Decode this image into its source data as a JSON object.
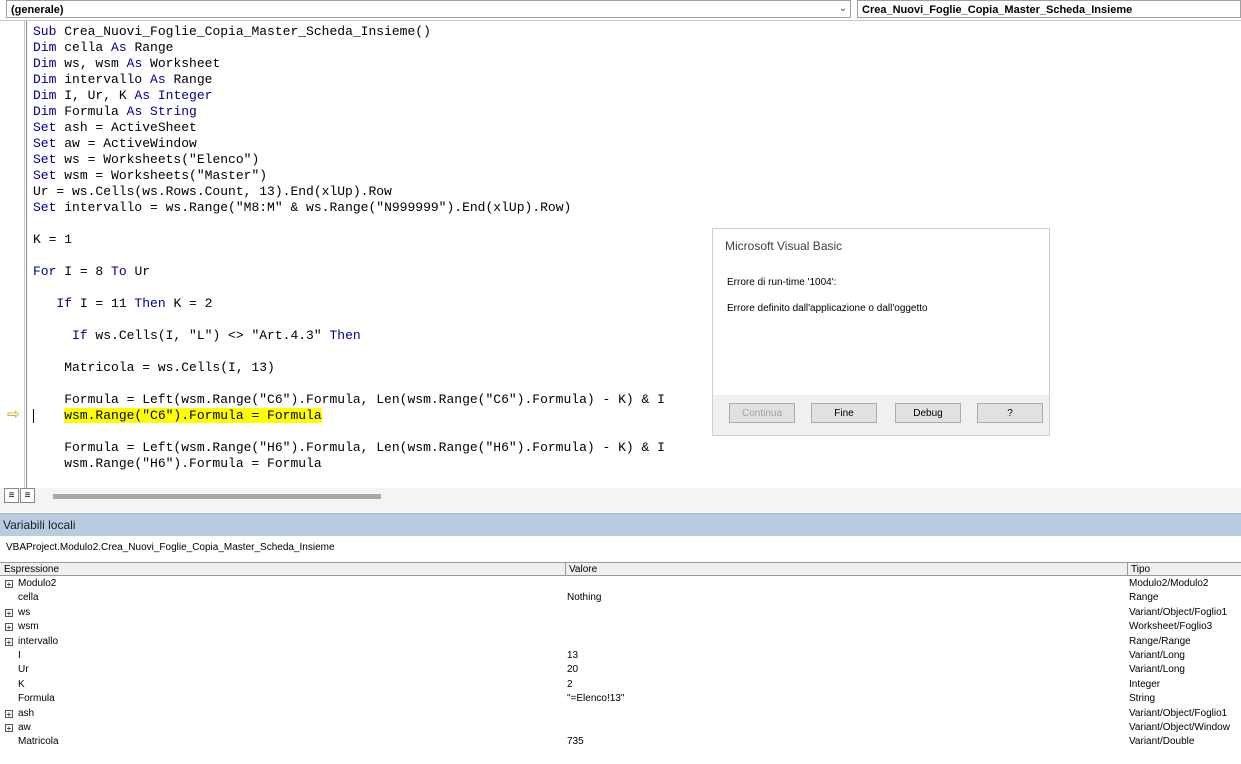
{
  "toolbar": {
    "object_combo": "(generale)",
    "procedure_combo": "Crea_Nuovi_Foglie_Copia_Master_Scheda_Insieme"
  },
  "code_lines": [
    [
      {
        "t": "Sub ",
        "k": true
      },
      {
        "t": "Crea_Nuovi_Foglie_Copia_Master_Scheda_Insieme()"
      }
    ],
    [
      {
        "t": "Dim ",
        "k": true
      },
      {
        "t": "cella "
      },
      {
        "t": "As ",
        "k": true
      },
      {
        "t": "Range"
      }
    ],
    [
      {
        "t": "Dim ",
        "k": true
      },
      {
        "t": "ws, wsm "
      },
      {
        "t": "As ",
        "k": true
      },
      {
        "t": "Worksheet"
      }
    ],
    [
      {
        "t": "Dim ",
        "k": true
      },
      {
        "t": "intervallo "
      },
      {
        "t": "As ",
        "k": true
      },
      {
        "t": "Range"
      }
    ],
    [
      {
        "t": "Dim ",
        "k": true
      },
      {
        "t": "I, Ur, K "
      },
      {
        "t": "As Integer",
        "k": true
      }
    ],
    [
      {
        "t": "Dim ",
        "k": true
      },
      {
        "t": "Formula "
      },
      {
        "t": "As String",
        "k": true
      }
    ],
    [
      {
        "t": "Set ",
        "k": true
      },
      {
        "t": "ash = ActiveSheet"
      }
    ],
    [
      {
        "t": "Set ",
        "k": true
      },
      {
        "t": "aw = ActiveWindow"
      }
    ],
    [
      {
        "t": "Set ",
        "k": true
      },
      {
        "t": "ws = Worksheets(\"Elenco\")"
      }
    ],
    [
      {
        "t": "Set ",
        "k": true
      },
      {
        "t": "wsm = Worksheets(\"Master\")"
      }
    ],
    [
      {
        "t": "Ur = ws.Cells(ws.Rows.Count, 13).End(xlUp).Row"
      }
    ],
    [
      {
        "t": "Set ",
        "k": true
      },
      {
        "t": "intervallo = ws.Range(\"M8:M\" & ws.Range(\"N999999\").End(xlUp).Row)"
      }
    ],
    [],
    [
      {
        "t": "K = 1"
      }
    ],
    [],
    [
      {
        "t": "For ",
        "k": true
      },
      {
        "t": "I = 8 "
      },
      {
        "t": "To ",
        "k": true
      },
      {
        "t": "Ur"
      }
    ],
    [],
    [
      {
        "t": "   "
      },
      {
        "t": "If ",
        "k": true
      },
      {
        "t": "I = 11 "
      },
      {
        "t": "Then ",
        "k": true
      },
      {
        "t": "K = 2"
      }
    ],
    [],
    [
      {
        "t": "     "
      },
      {
        "t": "If ",
        "k": true
      },
      {
        "t": "ws.Cells(I, \"L\") <> \"Art.4.3\" "
      },
      {
        "t": "Then",
        "k": true
      }
    ],
    [],
    [
      {
        "t": "    Matricola = ws.Cells(I, 13)"
      }
    ],
    [],
    [
      {
        "t": "    Formula = Left(wsm.Range(\"C6\").Formula, Len(wsm.Range(\"C6\").Formula) - K) & I"
      }
    ],
    [
      {
        "t": "    "
      },
      {
        "t": "wsm.Range(\"C6\").Formula = Formula",
        "h": true
      }
    ],
    [],
    [
      {
        "t": "    Formula = Left(wsm.Range(\"H6\").Formula, Len(wsm.Range(\"H6\").Formula) - K) & I"
      }
    ],
    [
      {
        "t": "    wsm.Range(\"H6\").Formula = Formula"
      }
    ]
  ],
  "dialog": {
    "title": "Microsoft Visual Basic",
    "line1": "Errore di run-time '1004':",
    "line2": "Errore definito dall'applicazione o dall'oggetto",
    "btn_continue": "Continua",
    "btn_end": "Fine",
    "btn_debug": "Debug",
    "btn_help": "?"
  },
  "locals": {
    "title": "Variabili locali",
    "context": "VBAProject.Modulo2.Crea_Nuovi_Foglie_Copia_Master_Scheda_Insieme",
    "col_expr": "Espressione",
    "col_value": "Valore",
    "col_type": "Tipo",
    "rows": [
      {
        "expr": "Modulo2",
        "value": "",
        "type": "Modulo2/Modulo2",
        "expand": true
      },
      {
        "expr": "cella",
        "value": "Nothing",
        "type": "Range",
        "expand": false
      },
      {
        "expr": "ws",
        "value": "",
        "type": "Variant/Object/Foglio1",
        "expand": true
      },
      {
        "expr": "wsm",
        "value": "",
        "type": "Worksheet/Foglio3",
        "expand": true
      },
      {
        "expr": "intervallo",
        "value": "",
        "type": "Range/Range",
        "expand": true
      },
      {
        "expr": "I",
        "value": "13",
        "type": "Variant/Long",
        "expand": false
      },
      {
        "expr": "Ur",
        "value": "20",
        "type": "Variant/Long",
        "expand": false
      },
      {
        "expr": "K",
        "value": "2",
        "type": "Integer",
        "expand": false
      },
      {
        "expr": "Formula",
        "value": "\"=Elenco!13\"",
        "type": "String",
        "expand": false
      },
      {
        "expr": "ash",
        "value": "",
        "type": "Variant/Object/Foglio1",
        "expand": true
      },
      {
        "expr": "aw",
        "value": "",
        "type": "Variant/Object/Window",
        "expand": true
      },
      {
        "expr": "Matricola",
        "value": "735",
        "type": "Variant/Double",
        "expand": false
      }
    ]
  },
  "colors": {
    "keyword": "#00008b",
    "highlight": "#ffff00",
    "locals_title_bg": "#b7cce0"
  }
}
